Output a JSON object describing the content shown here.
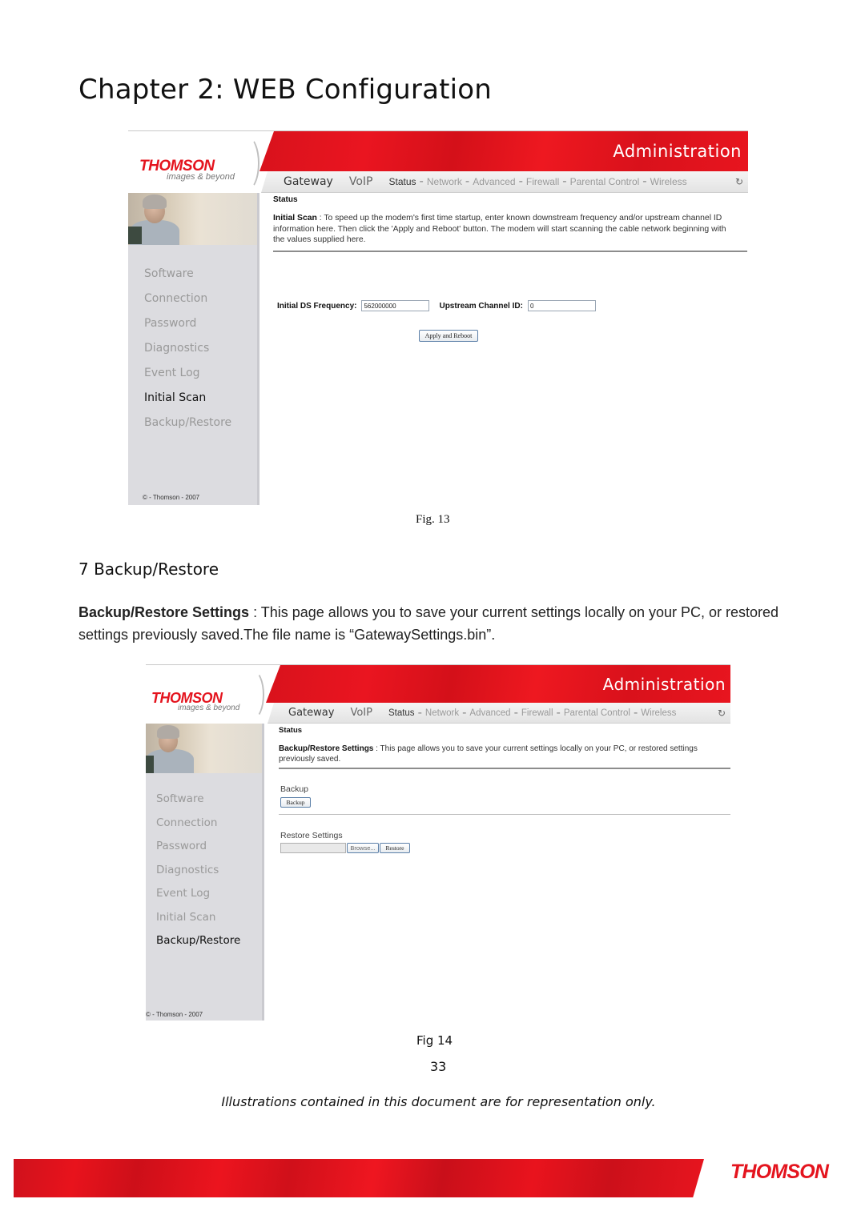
{
  "document": {
    "chapter_title": "Chapter 2: WEB Configuration",
    "section_heading": "7 Backup/Restore",
    "body_text_bold": "Backup/Restore Settings",
    "body_text_sep": " : ",
    "body_text": " This page allows you to save your current settings locally on your PC, or restored settings previously saved.The file name is “GatewaySettings.bin”.",
    "fig13_caption": "Fig. 13",
    "fig14_caption": "Fig 14",
    "page_number": "33",
    "disclaimer": "Illustrations contained in this document are for representation only.",
    "footer_logo": "THOMSON"
  },
  "ui": {
    "logo": "THOMSON",
    "tagline": "images & beyond",
    "banner_title": "Administration",
    "nav_main": [
      "Gateway",
      "VoIP"
    ],
    "nav_sub": [
      "Status",
      "Network",
      "Advanced",
      "Firewall",
      "Parental Control",
      "Wireless"
    ],
    "nav_separator": "-",
    "refresh_icon": "↻",
    "sidebar_items": [
      "Software",
      "Connection",
      "Password",
      "Diagnostics",
      "Event Log",
      "Initial Scan",
      "Backup/Restore"
    ],
    "copyright": "© - Thomson - 2007",
    "status_heading": "Status"
  },
  "fig13": {
    "active_sidebar_item": "Initial Scan",
    "desc_title": "Initial Scan",
    "desc_sep": " : ",
    "desc_text": " To speed up the modem's first time startup, enter known downstream frequency and/or upstream channel ID information here. Then click the 'Apply and Reboot' button. The modem will start scanning the cable network beginning with the values supplied here.",
    "ds_freq_label": "Initial DS Frequency:",
    "ds_freq_value": "562000000",
    "us_channel_label": "Upstream Channel ID:",
    "us_channel_value": "0",
    "apply_button": "Apply and Reboot"
  },
  "fig14": {
    "active_sidebar_item": "Backup/Restore",
    "desc_title": "Backup/Restore Settings",
    "desc_sep": " : ",
    "desc_text": " This page allows you to save your current settings locally on your PC, or restored settings previously saved.",
    "backup_label": "Backup",
    "backup_button": "Backup",
    "restore_label": "Restore Settings",
    "file_value": "",
    "browse_button": "Browse...",
    "restore_button": "Restore"
  },
  "colors": {
    "brand_red": "#e4141e",
    "sidebar_bg": "#dcdce0",
    "menu_inactive": "#999999",
    "menu_active": "#111111"
  }
}
